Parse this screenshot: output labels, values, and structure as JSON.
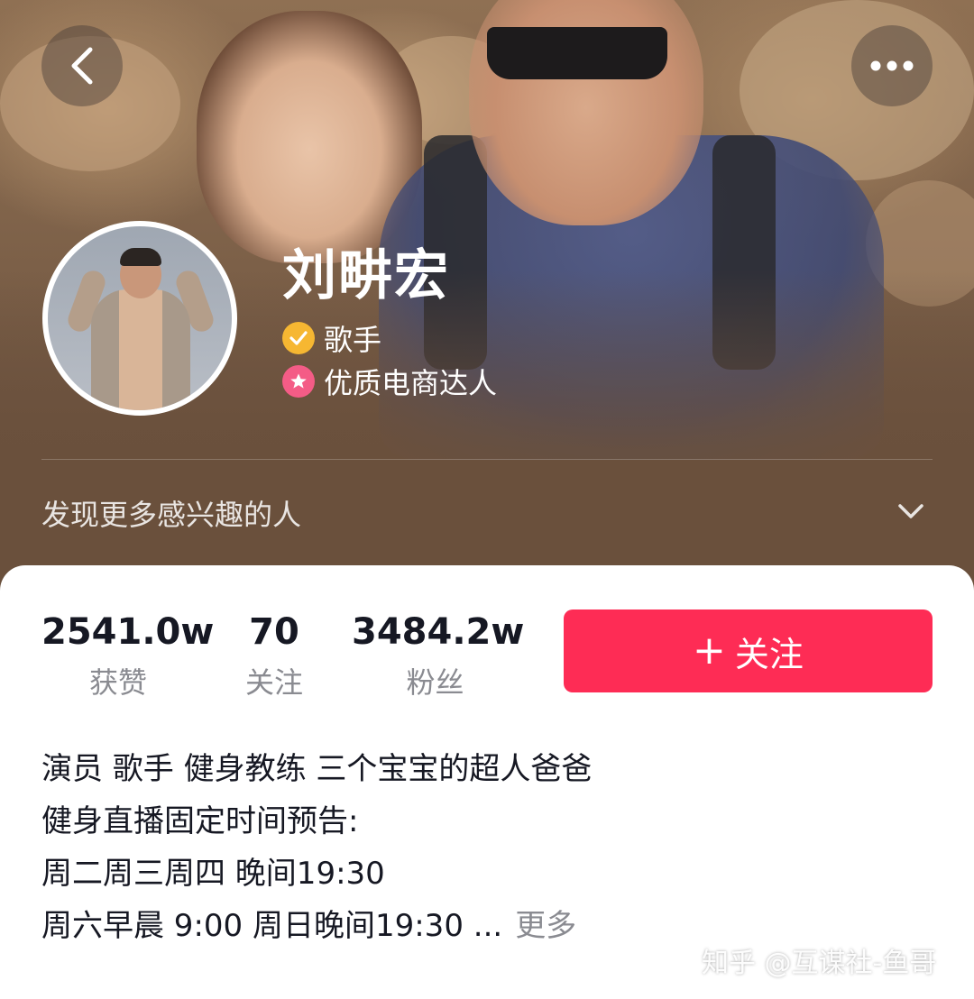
{
  "header": {
    "back_icon": "chevron-left-icon",
    "more_icon": "more-dots-icon"
  },
  "profile": {
    "name": "刘畊宏",
    "tags": [
      {
        "icon": "verified-check-icon",
        "label": "歌手",
        "color": "#f6b732"
      },
      {
        "icon": "star-badge-icon",
        "label": "优质电商达人",
        "color": "#f45c86"
      }
    ]
  },
  "discover": {
    "label": "发现更多感兴趣的人",
    "icon": "chevron-down-icon"
  },
  "stats": [
    {
      "value": "2541.0w",
      "label": "获赞"
    },
    {
      "value": "70",
      "label": "关注"
    },
    {
      "value": "3484.2w",
      "label": "粉丝"
    }
  ],
  "follow_button": {
    "icon": "+",
    "label": "关注",
    "color": "#fe2c55"
  },
  "bio": {
    "lines": [
      "演员 歌手 健身教练 三个宝宝的超人爸爸",
      "健身直播固定时间预告:",
      "周二周三周四 晚间19:30",
      "周六早晨 9:00 周日晚间19:30 ..."
    ],
    "more": "更多"
  },
  "watermark": "知乎 @互谋社-鱼哥"
}
